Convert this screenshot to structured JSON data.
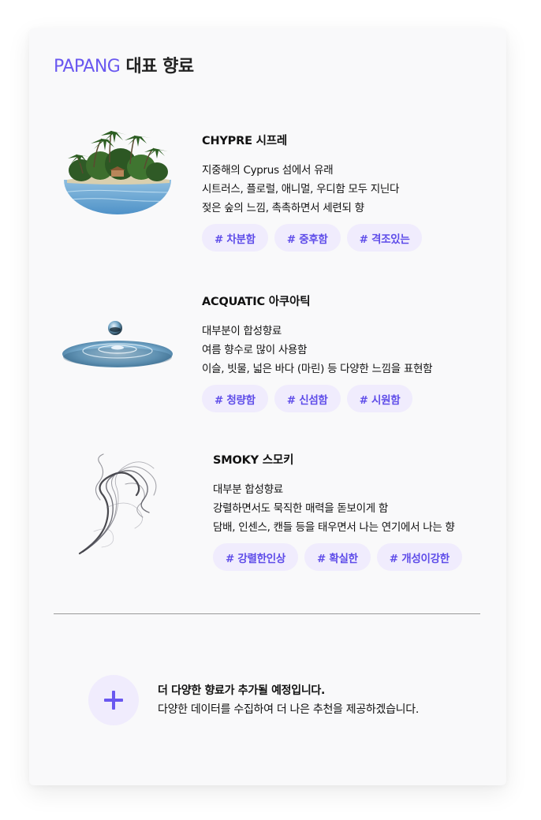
{
  "card": {
    "brand": "PAPANG",
    "title_rest": "대표 향료"
  },
  "items": [
    {
      "title": "CHYPRE 시프레",
      "desc": [
        "지중해의 Cyprus 섬에서 유래",
        "시트러스, 플로럴, 애니멀, 우디함 모두 지닌다",
        "젖은 숲의 느낌, 촉촉하면서 세련되 향"
      ],
      "tags": [
        "# 차분함",
        "# 중후함",
        "# 격조있는"
      ],
      "image": "tropical-island"
    },
    {
      "title": "ACQUATIC 아쿠아틱",
      "desc": [
        "대부분이 합성향료",
        "여름 향수로 많이 사용함",
        "이슬, 빗물, 넓은 바다 (마린) 등 다양한 느낌을 표현함"
      ],
      "tags": [
        "# 청량함",
        "# 신섬함",
        "# 시원함"
      ],
      "image": "water-droplet"
    },
    {
      "title": "SMOKY 스모키",
      "desc": [
        "대부분 합성향료",
        "강렬하면서도 묵직한 매력을 돋보이게 함",
        "담배, 인센스, 캔들 등을 태우면서 나는 연기에서 나는 향"
      ],
      "tags": [
        "# 강렬한인상",
        "# 확실한",
        "# 개성이강한"
      ],
      "image": "smoke"
    }
  ],
  "more": {
    "title": "더 다양한 향료가 추가될 예정입니다.",
    "subtitle": "다양한 데이터를 수집하여 더 나은 추천을 제공하겠습니다.",
    "icon": "plus-icon"
  },
  "colors": {
    "accent": "#6a58f0",
    "tag_bg": "#f0ecfd",
    "tag_text": "#5e4ce9",
    "card_bg": "#f9f9fa"
  }
}
